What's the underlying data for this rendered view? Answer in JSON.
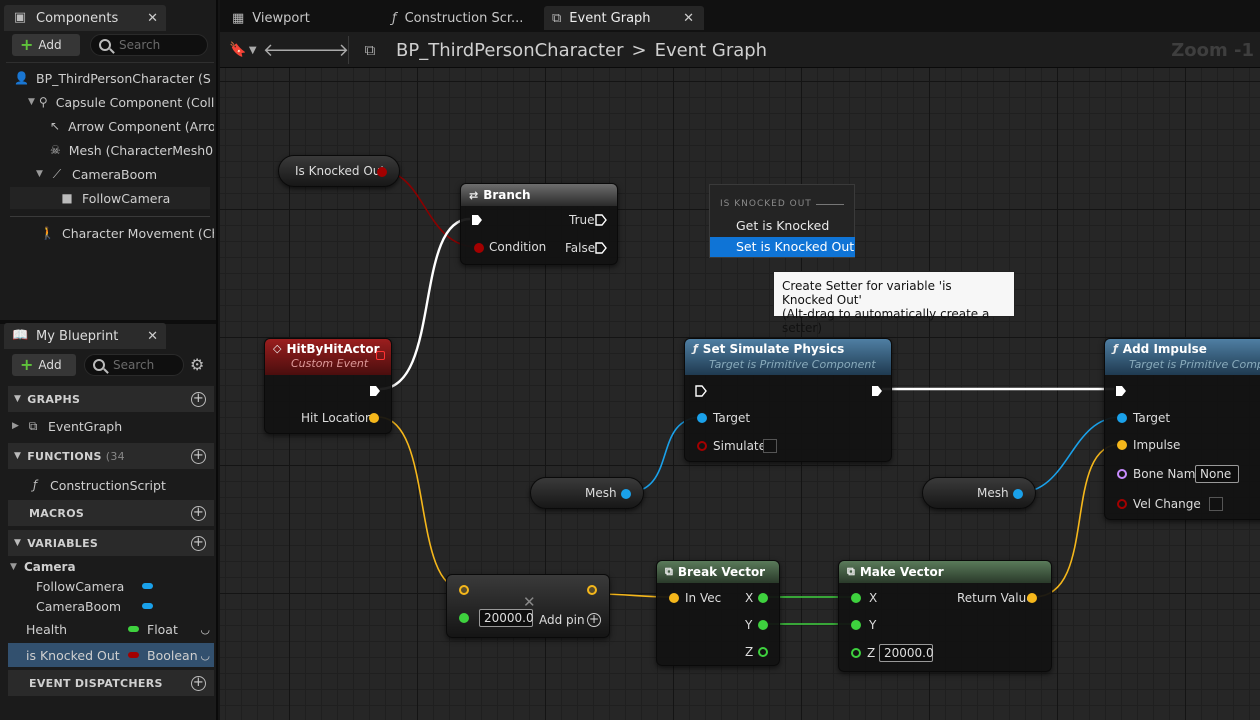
{
  "components_panel": {
    "tab_label": "Components",
    "add_label": "Add",
    "search_placeholder": "Search",
    "tree": [
      {
        "label": "BP_ThirdPersonCharacter (S",
        "icon": "character-icon"
      },
      {
        "label": "Capsule Component (Collis",
        "icon": "capsule-icon"
      },
      {
        "label": "Arrow Component (Arrow",
        "icon": "arrow-icon"
      },
      {
        "label": "Mesh (CharacterMesh0)",
        "icon": "skeleton-icon"
      },
      {
        "label": "CameraBoom",
        "icon": "boom-icon"
      },
      {
        "label": "FollowCamera",
        "icon": "camera-icon"
      },
      {
        "label": "Character Movement (Cha",
        "icon": "movement-icon"
      }
    ]
  },
  "my_blueprint": {
    "tab_label": "My Blueprint",
    "add_label": "Add",
    "search_placeholder": "Search",
    "sections": {
      "graphs": "GRAPHS",
      "functions": "FUNCTIONS",
      "functions_count": "(34",
      "macros": "MACROS",
      "variables": "VARIABLES",
      "event_dispatchers": "EVENT DISPATCHERS"
    },
    "graph_items": [
      "EventGraph"
    ],
    "function_items": [
      "ConstructionScript"
    ],
    "variable_category": "Camera",
    "variables": [
      {
        "name": "FollowCamera",
        "type": "",
        "color": "#1aa1ea"
      },
      {
        "name": "CameraBoom",
        "type": "",
        "color": "#1aa1ea"
      },
      {
        "name": "Health",
        "type": "Float",
        "color": "#3ed13e"
      },
      {
        "name": "is Knocked Out",
        "type": "Boolean",
        "color": "#a30000"
      }
    ]
  },
  "doc_tabs": [
    {
      "label": "Viewport",
      "icon": "viewport-icon"
    },
    {
      "label": "Construction Scr...",
      "icon": "function-icon"
    },
    {
      "label": "Event Graph",
      "icon": "graph-icon"
    }
  ],
  "breadcrumb": {
    "blueprint": "BP_ThirdPersonCharacter",
    "separator": ">",
    "graph": "Event Graph",
    "zoom": "Zoom -1"
  },
  "graph": {
    "var_is_knocked_out": "Is Knocked Out",
    "branch": {
      "title": "Branch",
      "true": "True",
      "false": "False",
      "condition": "Condition"
    },
    "hit_event": {
      "title": "HitByHitActor",
      "subtitle": "Custom Event",
      "hit_location": "Hit Location"
    },
    "set_sim": {
      "title": "Set Simulate Physics",
      "subtitle": "Target is Primitive Component",
      "target": "Target",
      "simulate": "Simulate"
    },
    "add_impulse": {
      "title": "Add Impulse",
      "subtitle": "Target is Primitive Comp",
      "target": "Target",
      "impulse": "Impulse",
      "bone_name": "Bone Name",
      "bone_value": "None",
      "vel_change": "Vel Change"
    },
    "mesh_1": "Mesh",
    "mesh_2": "Mesh",
    "multiply": {
      "value": "20000.0",
      "add_pin": "Add pin"
    },
    "break_vector": {
      "title": "Break Vector",
      "in": "In Vec",
      "x": "X",
      "y": "Y",
      "z": "Z"
    },
    "make_vector": {
      "title": "Make Vector",
      "x": "X",
      "y": "Y",
      "z": "Z",
      "z_value": "20000.0",
      "return": "Return Value"
    }
  },
  "context_menu": {
    "header": "IS KNOCKED OUT",
    "items": [
      "Get is Knocked Out",
      "Set is Knocked Out"
    ],
    "selected_index": 1
  },
  "tooltip": {
    "line1": "Create Setter for variable 'is Knocked Out'",
    "line2": "(Alt-drag to automatically create a setter)"
  },
  "colors": {
    "exec": "#ffffff",
    "bool": "#a30000",
    "vector": "#f5b71b",
    "float": "#3ed13e",
    "object": "#1aa1ea",
    "name": "#c88cff",
    "event_header": "#8a1a1a",
    "function_header": "#3c6a8a",
    "struct_header": "#4c6a4c",
    "selection": "#0f74d6"
  }
}
